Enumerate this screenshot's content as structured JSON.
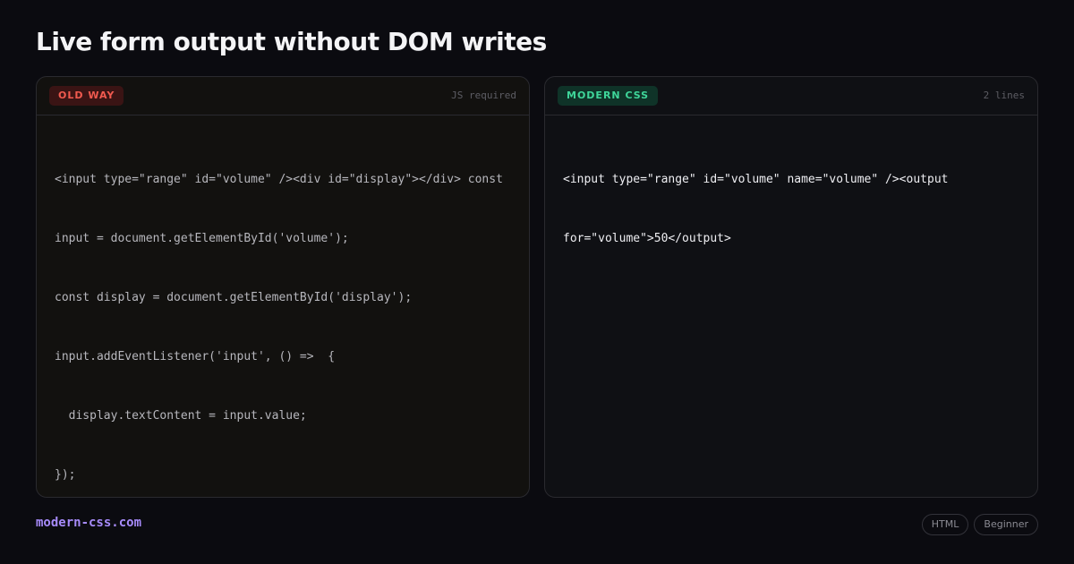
{
  "page": {
    "title": "Live form output without DOM writes"
  },
  "old_panel": {
    "badge": "OLD WAY",
    "meta": "JS required",
    "code_lines": [
      "<input type=\"range\" id=\"volume\" /><div id=\"display\"></div> const",
      "input = document.getElementById('volume');",
      "const display = document.getElementById('display');",
      "input.addEventListener('input', () =>  {",
      "  display.textContent = input.value;",
      "});"
    ]
  },
  "modern_panel": {
    "badge": "MODERN CSS",
    "meta": "2 lines",
    "code_lines": [
      "<input type=\"range\" id=\"volume\" name=\"volume\" /><output",
      "for=\"volume\">50</output>"
    ]
  },
  "footer": {
    "brand": "modern-css.com",
    "tags": [
      "HTML",
      "Beginner"
    ]
  },
  "colors": {
    "background": "#0b0b10",
    "old_accent": "#f15a4f",
    "modern_accent": "#3fd69a",
    "brand": "#a78bfa"
  }
}
